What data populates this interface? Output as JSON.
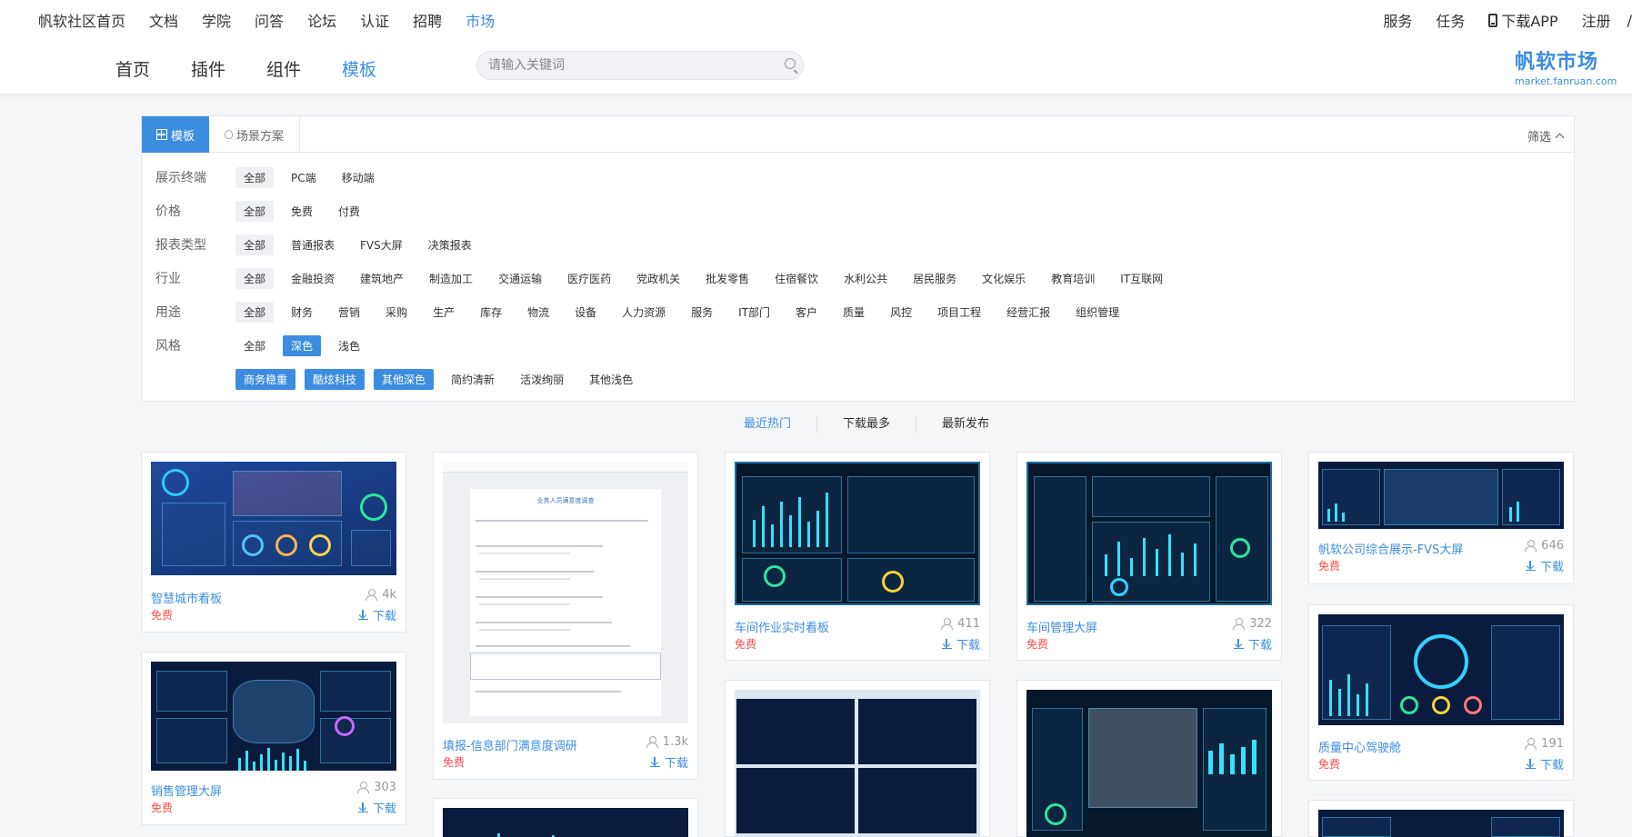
{
  "top_nav": [
    "帆软社区首页",
    "文档",
    "学院",
    "问答",
    "论坛",
    "认证",
    "招聘",
    "市场"
  ],
  "top_nav_active": "市场",
  "top_right": {
    "service": "服务",
    "task": "任务",
    "download_app": "下载APP",
    "register": "注册",
    "sep": "/"
  },
  "sub_nav": [
    "首页",
    "插件",
    "组件",
    "模板"
  ],
  "sub_nav_active": "模板",
  "search": {
    "placeholder": "请输入关键词"
  },
  "brand": {
    "name": "帆软市场",
    "url_text": "market.fanruan.com"
  },
  "filter": {
    "tabs": [
      "模板",
      "场景方案"
    ],
    "collapse_label": "筛选",
    "rows": [
      {
        "label": "展示终端",
        "options": [
          "全部",
          "PC端",
          "移动端"
        ],
        "selected": "全部"
      },
      {
        "label": "价格",
        "options": [
          "全部",
          "免费",
          "付费"
        ],
        "selected": "全部"
      },
      {
        "label": "报表类型",
        "options": [
          "全部",
          "普通报表",
          "FVS大屏",
          "决策报表"
        ],
        "selected": "全部"
      },
      {
        "label": "行业",
        "options": [
          "全部",
          "金融投资",
          "建筑地产",
          "制造加工",
          "交通运输",
          "医疗医药",
          "党政机关",
          "批发零售",
          "住宿餐饮",
          "水利公共",
          "居民服务",
          "文化娱乐",
          "教育培训",
          "IT互联网"
        ],
        "selected": "全部"
      },
      {
        "label": "用途",
        "options": [
          "全部",
          "财务",
          "营销",
          "采购",
          "生产",
          "库存",
          "物流",
          "设备",
          "人力资源",
          "服务",
          "IT部门",
          "客户",
          "质量",
          "风控",
          "项目工程",
          "经营汇报",
          "组织管理"
        ],
        "selected": "全部"
      },
      {
        "label": "风格",
        "options": [
          "全部",
          "深色",
          "浅色"
        ],
        "selected": "深色"
      }
    ],
    "style_sub_options": [
      "商务稳重",
      "酷炫科技",
      "其他深色",
      "简约清新",
      "活泼绚丽",
      "其他浅色"
    ],
    "style_sub_selected": [
      "商务稳重",
      "酷炫科技",
      "其他深色"
    ]
  },
  "sort_tabs": [
    "最近热门",
    "下载最多",
    "最新发布"
  ],
  "sort_active": "最近热门",
  "cards": [
    {
      "title": "智慧城市看板",
      "price": "免费",
      "views": "4k",
      "download": "下载"
    },
    {
      "title": "销售管理大屏",
      "price": "免费",
      "views": "303",
      "download": "下载"
    },
    {
      "title": "填报-信息部门满意度调研",
      "price": "免费",
      "views": "1.3k",
      "download": "下载"
    },
    {
      "title": "车间作业实时看板",
      "price": "免费",
      "views": "411",
      "download": "下载"
    },
    {
      "title": "车间管理大屏",
      "price": "免费",
      "views": "322",
      "download": "下载"
    },
    {
      "title": "帆软公司综合展示-FVS大屏",
      "price": "免费",
      "views": "646",
      "download": "下载"
    },
    {
      "title": "质量中心驾驶舱",
      "price": "免费",
      "views": "191",
      "download": "下载"
    }
  ],
  "survey_doc_title": "业务人员满意度调查"
}
